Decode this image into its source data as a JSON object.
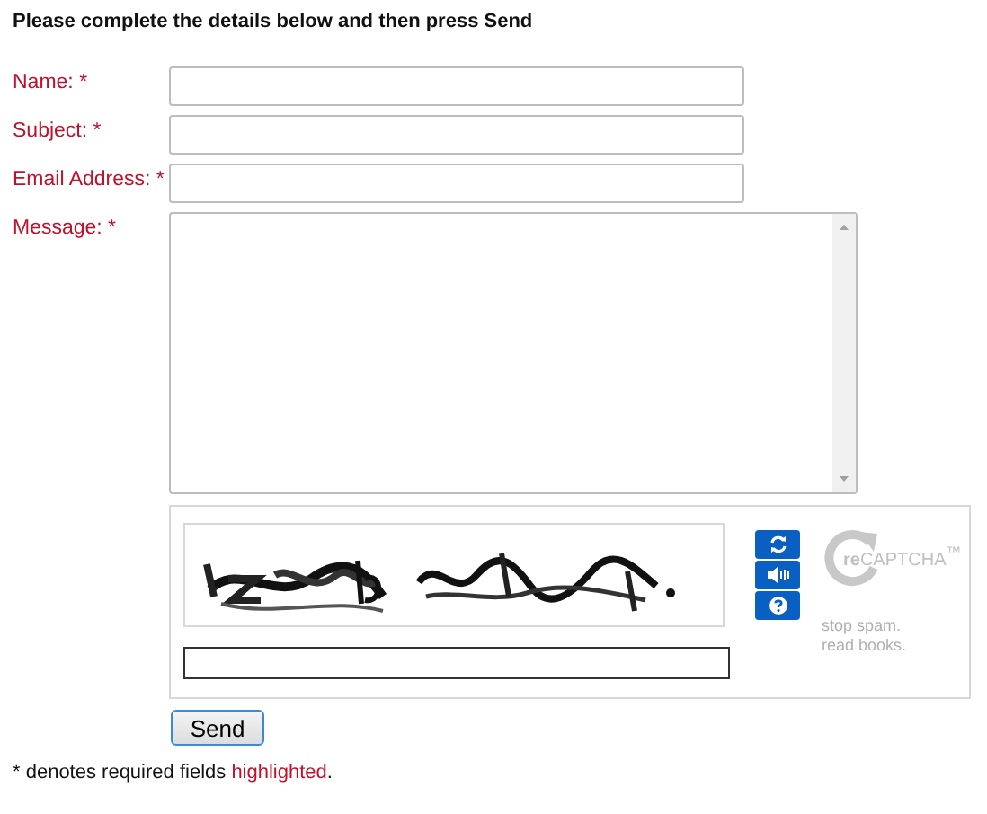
{
  "heading": "Please complete the details below and then press Send",
  "fields": [
    {
      "label": "Name: *",
      "kind": "input"
    },
    {
      "label": "Subject: *",
      "kind": "input"
    },
    {
      "label": "Email Address: *",
      "kind": "input"
    },
    {
      "label": "Message: *",
      "kind": "textarea"
    }
  ],
  "captcha": {
    "logo": "**re**CAPTCHA$^{™}$",
    "tagline": [
      "stop spam.",
      "read books."
    ]
  },
  "send_button": "Send",
  "footer": {
    "text": "* denotes required fields",
    "highlight": "highlighted",
    "end": "."
  }
}
